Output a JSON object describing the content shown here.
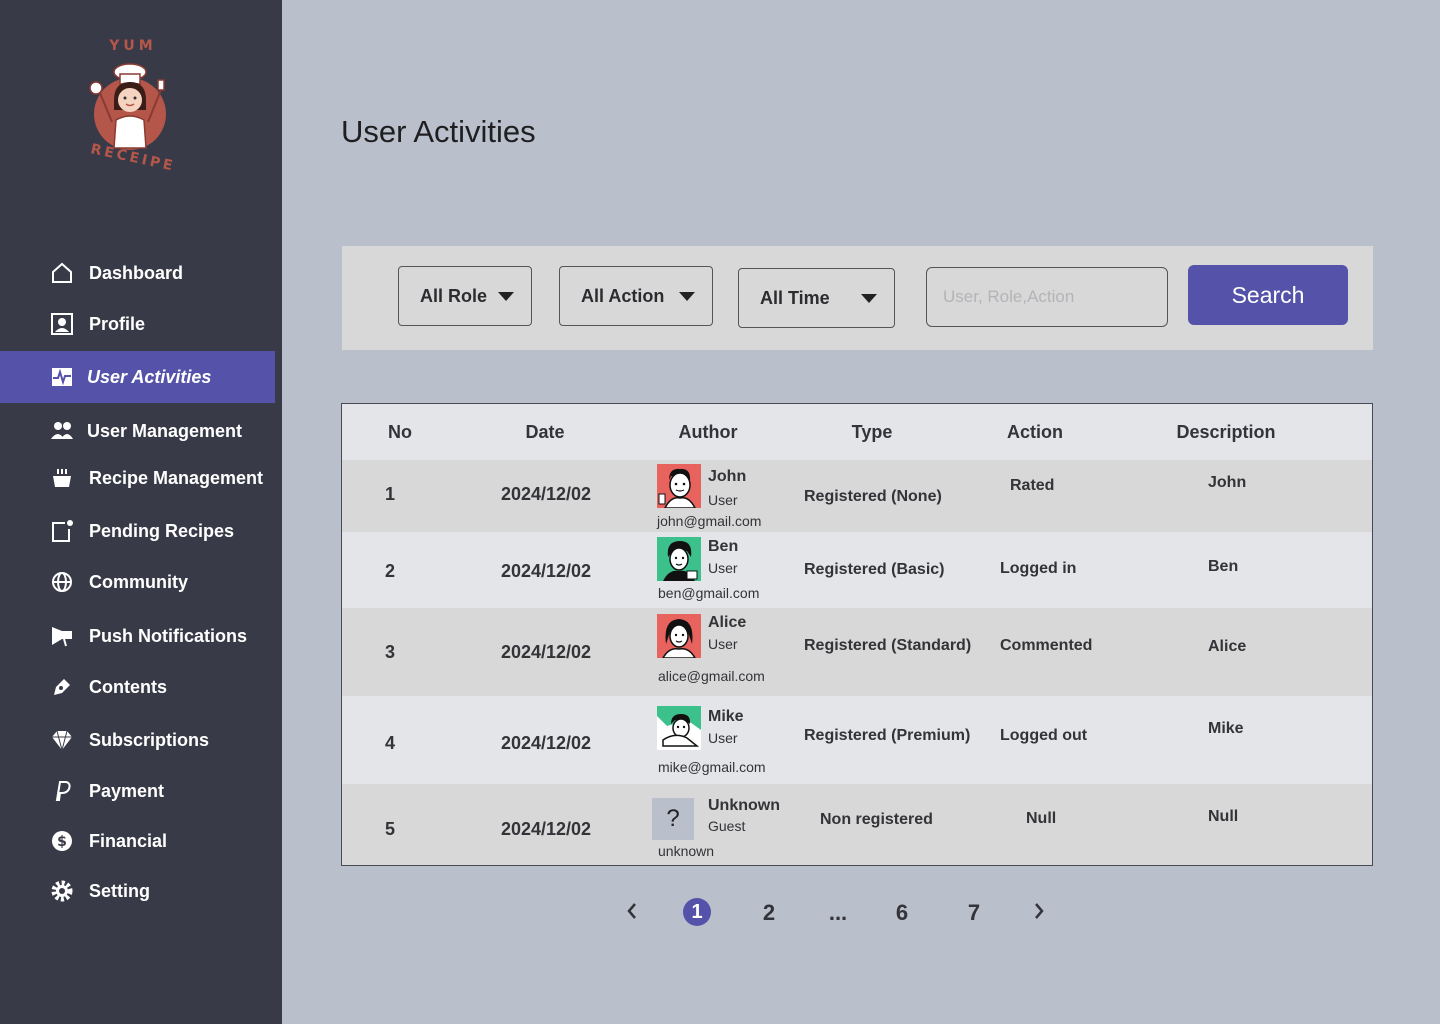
{
  "logo": {
    "top_text": "YUM",
    "bottom_text": "RECEIPE"
  },
  "sidebar": {
    "items": [
      {
        "label": "Dashboard",
        "icon": "home-icon"
      },
      {
        "label": "Profile",
        "icon": "profile-icon"
      },
      {
        "label": "User Activities",
        "icon": "activity-icon",
        "active": true
      },
      {
        "label": "User Management",
        "icon": "users-icon"
      },
      {
        "label": "Recipe Management",
        "icon": "pot-icon"
      },
      {
        "label": "Pending Recipes",
        "icon": "pending-icon"
      },
      {
        "label": "Community",
        "icon": "globe-icon"
      },
      {
        "label": "Push Notifications",
        "icon": "megaphone-icon"
      },
      {
        "label": "Contents",
        "icon": "pen-icon"
      },
      {
        "label": "Subscriptions",
        "icon": "diamond-icon"
      },
      {
        "label": "Payment",
        "icon": "paypal-icon"
      },
      {
        "label": "Financial",
        "icon": "dollar-icon"
      },
      {
        "label": "Setting",
        "icon": "gear-icon"
      }
    ]
  },
  "page": {
    "title": "User Activities"
  },
  "filters": {
    "role": "All Role",
    "action": "All Action",
    "time": "All Time",
    "search_placeholder": "User, Role,Action",
    "search_button": "Search"
  },
  "table": {
    "headers": {
      "no": "No",
      "date": "Date",
      "author": "Author",
      "type": "Type",
      "action": "Action",
      "description": "Description"
    },
    "rows": [
      {
        "no": "1",
        "date": "2024/12/02",
        "name": "John",
        "role": "User",
        "email": "john@gmail.com",
        "type": "Registered (None)",
        "action": "Rated",
        "description": "John",
        "avatar_color": "#e8625e"
      },
      {
        "no": "2",
        "date": "2024/12/02",
        "name": "Ben",
        "role": "User",
        "email": "ben@gmail.com",
        "type": "Registered (Basic)",
        "action": "Logged in",
        "description": "Ben",
        "avatar_color": "#3cc08c"
      },
      {
        "no": "3",
        "date": "2024/12/02",
        "name": "Alice",
        "role": "User",
        "email": "alice@gmail.com",
        "type": "Registered (Standard)",
        "action": "Commented",
        "description": "Alice",
        "avatar_color": "#e8625e"
      },
      {
        "no": "4",
        "date": "2024/12/02",
        "name": "Mike",
        "role": "User",
        "email": "mike@gmail.com",
        "type": "Registered (Premium)",
        "action": "Logged out",
        "description": "Mike",
        "avatar_color": "#3cc08c"
      },
      {
        "no": "5",
        "date": "2024/12/02",
        "name": "Unknown",
        "role": "Guest",
        "email": "unknown",
        "type": "Non registered",
        "action": "Null",
        "description": "Null",
        "avatar_glyph": "?"
      }
    ]
  },
  "pagination": {
    "pages": [
      "1",
      "2",
      "...",
      "6",
      "7"
    ],
    "current": "1"
  },
  "colors": {
    "sidebar": "#393a47",
    "accent": "#5553a9",
    "background": "#b9bfcb"
  }
}
